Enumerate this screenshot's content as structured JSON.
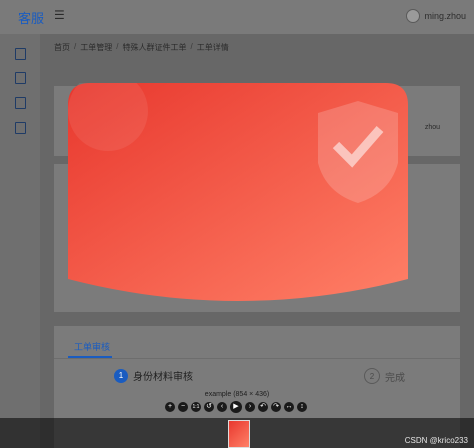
{
  "app": {
    "brand": "客服"
  },
  "header": {
    "user_name": "ming.zhou"
  },
  "breadcrumb": {
    "items": [
      "首页",
      "工单管理",
      "特殊人群证件工单",
      "工单详情"
    ],
    "sep": "/"
  },
  "card1": {
    "partial_text": "zhou"
  },
  "tabs": {
    "active": "工单审核"
  },
  "steps": [
    {
      "number": "1",
      "label": "身份材料审核"
    },
    {
      "number": "2",
      "label": "完成"
    }
  ],
  "viewer": {
    "caption": "example (854 × 436)",
    "toolbar": {
      "zoom_in": "+",
      "zoom_out": "−",
      "one_to_one": "1:1",
      "reset": "↺",
      "prev": "‹",
      "play": "▶",
      "next": "›",
      "rotate_left": "↶",
      "rotate_right": "↷",
      "flip_h": "↔",
      "flip_v": "↕"
    }
  },
  "footer": {
    "watermark": "CSDN @krico233"
  },
  "colors": {
    "accent": "#1a5cc0",
    "image_red": "#e8382e",
    "image_orange": "#ff8067"
  }
}
